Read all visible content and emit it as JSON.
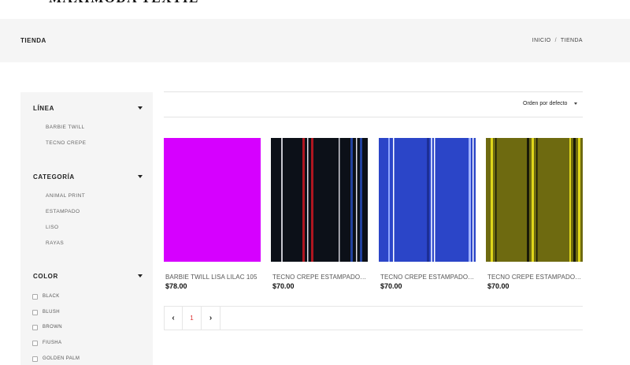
{
  "header": {
    "logo": "MAXIMODA TEXTIL"
  },
  "titlebar": {
    "title": "TIENDA",
    "breadcrumb": [
      "INICIO",
      "/",
      "TIENDA"
    ]
  },
  "sidebar": {
    "linea": {
      "title": "LÍNEA",
      "items": [
        "BARBIE TWILL",
        "TECNO CREPE"
      ]
    },
    "categoria": {
      "title": "CATEGORÍA",
      "items": [
        "ANIMAL PRINT",
        "ESTAMPADO",
        "LISO",
        "RAYAS"
      ]
    },
    "color": {
      "title": "COLOR",
      "items": [
        "BLACK",
        "BLUSH",
        "BROWN",
        "FIUSHA",
        "GOLDEN PALM"
      ]
    }
  },
  "toolbar": {
    "sort_label": "Orden por defecto"
  },
  "products": [
    {
      "name": "BARBIE TWILL LISA LILAC 105",
      "price": "$78.00",
      "swatch": "#d600ff"
    },
    {
      "name": "TECNO CREPE ESTAMPADO BLACK STRIPES",
      "price": "$70.00",
      "swatch": "#0c1018"
    },
    {
      "name": "TECNO CREPE ESTAMPADO NAVY STRIPES",
      "price": "$70.00",
      "swatch": "#2b45c8"
    },
    {
      "name": "TECNO CREPE ESTAMPADO YELLOW STRIPES",
      "price": "$70.00",
      "swatch": "#6e6a10"
    }
  ],
  "pagination": {
    "prev": "‹",
    "current": "1",
    "next": "›"
  }
}
